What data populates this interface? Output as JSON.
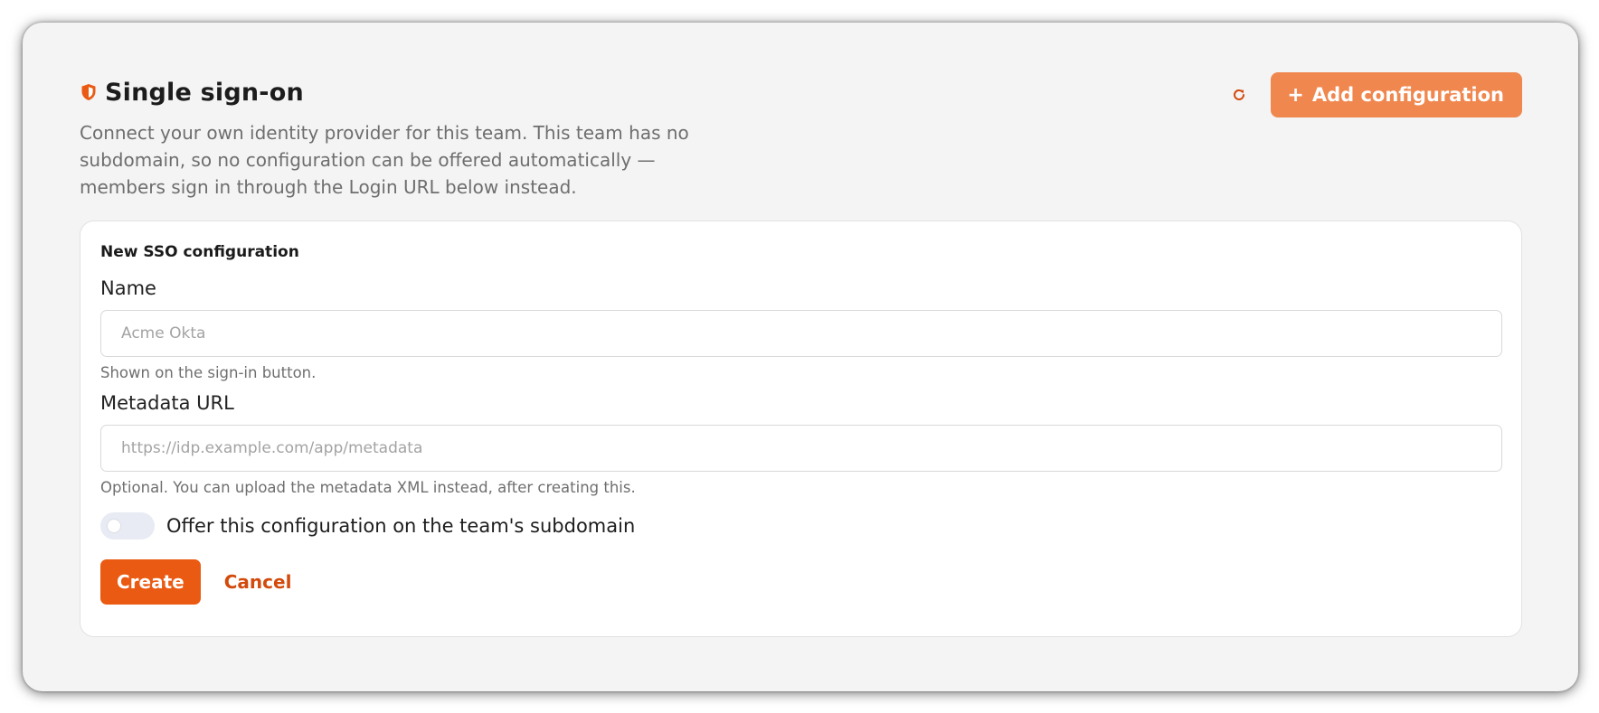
{
  "header": {
    "title": "Single sign-on",
    "description": "Connect your own identity provider for this team. This team has no subdomain, so no configuration can be offered automatically — members sign in through the Login URL below instead.",
    "add_button_label": "Add configuration",
    "shield_icon": "shield-icon",
    "refresh_icon": "refresh-icon",
    "plus_icon": "plus-icon"
  },
  "form": {
    "title": "New SSO configuration",
    "name": {
      "label": "Name",
      "placeholder": "Acme Okta",
      "value": "",
      "help": "Shown on the sign-in button."
    },
    "metadata_url": {
      "label": "Metadata URL",
      "placeholder": "https://idp.example.com/app/metadata",
      "value": "",
      "help": "Optional. You can upload the metadata XML instead, after creating this."
    },
    "subdomain_toggle": {
      "label": "Offer this configuration on the team's subdomain",
      "checked": false
    },
    "create_label": "Create",
    "cancel_label": "Cancel"
  },
  "colors": {
    "accent": "#ea5a12",
    "accent_light": "#f0874f",
    "cancel_text": "#d24a0c",
    "background": "#f4f4f4"
  }
}
